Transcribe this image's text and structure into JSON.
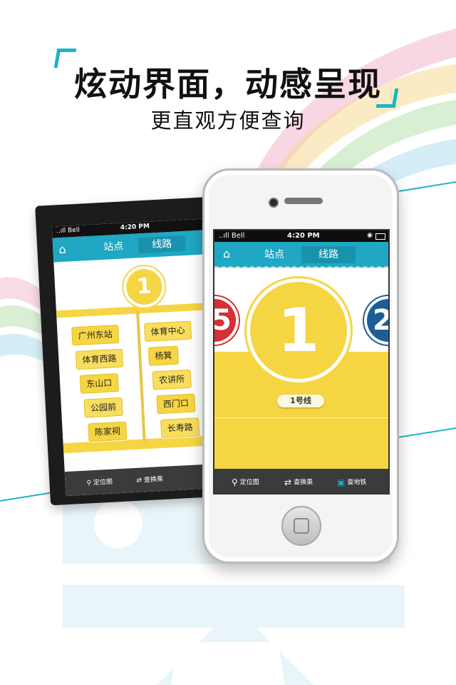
{
  "headline": {
    "title": "炫动界面，动感呈现",
    "subtitle": "更直观方便查询"
  },
  "colors": {
    "accent": "#1fa7c3",
    "yellow": "#f6d543",
    "red": "#d62f34",
    "blue": "#1d5f95",
    "toolbar": "#3b3b3b"
  },
  "back_phone": {
    "status": {
      "carrier": "..ıll Bell",
      "time": "4:20 PM"
    },
    "tabs": [
      {
        "label": "站点"
      },
      {
        "label": "线路"
      }
    ],
    "line_number": "1",
    "stops_left": [
      "广州东站",
      "体育西路",
      "东山口",
      "公园前",
      "陈家祠"
    ],
    "stops_right": [
      "体育中心",
      "杨箕",
      "农讲所",
      "西门口",
      "长寿路"
    ],
    "toolbar": [
      {
        "label": "定位图",
        "icon": "pin-icon"
      },
      {
        "label": "查换乘",
        "icon": "transfer-icon"
      }
    ]
  },
  "front_phone": {
    "status": {
      "carrier": "..ıll Bell",
      "time": "4:20 PM"
    },
    "tabs": [
      {
        "label": "站点"
      },
      {
        "label": "线路"
      }
    ],
    "current_line": "1",
    "prev_line": "5",
    "next_line": "2",
    "line_label": "1号线",
    "toolbar": [
      {
        "label": "定位图",
        "icon": "pin-icon"
      },
      {
        "label": "查换乘",
        "icon": "transfer-icon"
      },
      {
        "label": "查地铁",
        "icon": "subway-icon"
      }
    ]
  }
}
